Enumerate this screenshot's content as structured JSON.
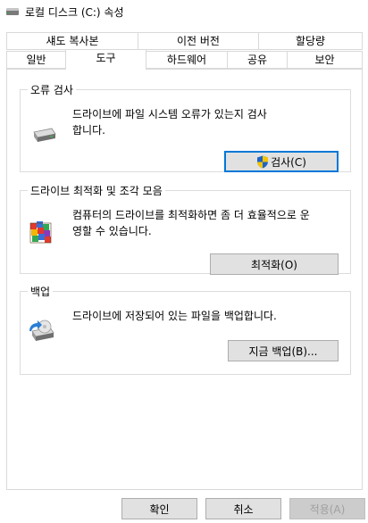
{
  "window": {
    "title": "로컬 디스크 (C:) 속성",
    "icon": "drive-icon"
  },
  "tabs_row1": [
    {
      "label": "섀도 복사본"
    },
    {
      "label": "이전 버전"
    },
    {
      "label": "할당량"
    }
  ],
  "tabs_row2": [
    {
      "label": "일반"
    },
    {
      "label": "도구",
      "selected": true
    },
    {
      "label": "하드웨어"
    },
    {
      "label": "공유"
    },
    {
      "label": "보안"
    }
  ],
  "error_check": {
    "legend": "오류 검사",
    "text1": "드라이브에 파일 시스템 오류가 있는지 검사",
    "text2": "합니다.",
    "button": "검사(C)",
    "icon": "hard-drive-icon"
  },
  "optimize": {
    "legend": "드라이브 최적화 및 조각 모음",
    "text1": "컴퓨터의 드라이브를 최적화하면 좀 더 효율적으로 운",
    "text2": "영할 수 있습니다.",
    "button": "최적화(O)",
    "icon": "defrag-icon"
  },
  "backup": {
    "legend": "백업",
    "text": "드라이브에 저장되어 있는 파일을 백업합니다.",
    "button": "지금 백업(B)...",
    "icon": "backup-icon"
  },
  "footer": {
    "ok": "확인",
    "cancel": "취소",
    "apply": "적용(A)"
  },
  "colors": {
    "accent": "#0078d7",
    "shield_blue": "#1e64c8",
    "shield_yellow": "#f5c400"
  }
}
